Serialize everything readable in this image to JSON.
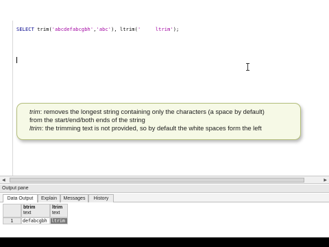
{
  "editor": {
    "sql": {
      "select_kw": "SELECT",
      "fn1": " trim(",
      "arg1": "'abcdefabcgbh'",
      "sep1": ",",
      "arg2": "'abc'",
      "mid": "), ltrim(",
      "arg3": "'     ltrim'",
      "end": ");"
    }
  },
  "note": {
    "line1_kw": "trim",
    "line1_rest": ": removes the longest string containing only the characters (a space by default)",
    "line2": "from the start/end/both ends of the string",
    "line3_kw": "ltrim",
    "line3_rest": ": the trimming text is not provided, so by default the white spaces form the left"
  },
  "output": {
    "pane_title": "Output pane",
    "tabs": [
      {
        "label": "Data Output",
        "active": true
      },
      {
        "label": "Explain",
        "active": false
      },
      {
        "label": "Messages",
        "active": false
      },
      {
        "label": "History",
        "active": false
      }
    ],
    "columns": [
      {
        "name": "btrim",
        "type": "text"
      },
      {
        "name": "ltrim",
        "type": "text"
      }
    ],
    "rows": [
      {
        "num": "1",
        "cells": [
          "defabcgbh",
          "ltrim"
        ]
      }
    ]
  },
  "icons": {
    "scroll_left": "arrow-left-icon",
    "scroll_right": "arrow-right-icon",
    "cursor": "text-cursor-icon"
  }
}
